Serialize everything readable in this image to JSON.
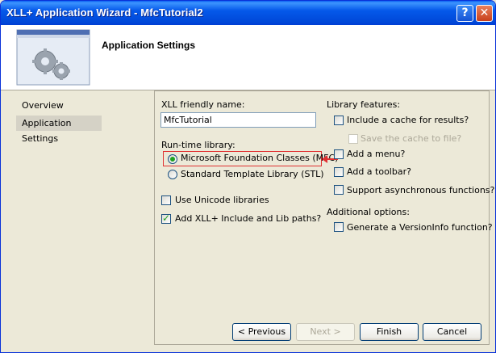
{
  "window": {
    "title": "XLL+ Application Wizard - MfcTutorial2"
  },
  "titlebar": {
    "help_glyph": "?",
    "close_glyph": "✕"
  },
  "header": {
    "title": "Application Settings",
    "image_icon": "gears-window-icon"
  },
  "sidebar": {
    "items": [
      {
        "label": "Overview",
        "selected": false
      },
      {
        "label": "Application Settings",
        "selected": true
      }
    ]
  },
  "form": {
    "friendly_name_label": "XLL friendly name:",
    "friendly_name_value": "MfcTutorial",
    "runtime_label": "Run-time library:",
    "radio_mfc": {
      "label": "Microsoft Foundation Classes (MFC)",
      "selected": true
    },
    "radio_stl": {
      "label": "Standard Template Library (STL)",
      "selected": false
    },
    "unicode": {
      "label": "Use Unicode libraries",
      "checked": false
    },
    "include_paths": {
      "label": "Add XLL+ Include and Lib paths?",
      "checked": true
    }
  },
  "library_features": {
    "label": "Library features:",
    "include_cache": {
      "label": "Include a cache for results?",
      "checked": false
    },
    "save_cache": {
      "label": "Save the cache to file?",
      "checked": false,
      "disabled": true
    },
    "add_menu": {
      "label": "Add a menu?",
      "checked": false
    },
    "add_toolbar": {
      "label": "Add a toolbar?",
      "checked": false
    },
    "async": {
      "label": "Support asynchronous functions?",
      "checked": false
    }
  },
  "additional_options": {
    "label": "Additional options:",
    "versioninfo": {
      "label": "Generate a VersionInfo function?",
      "checked": false
    }
  },
  "buttons": {
    "previous": "< Previous",
    "next": "Next >",
    "finish": "Finish",
    "cancel": "Cancel"
  },
  "colors": {
    "titlebar": "#0054e3",
    "dialog": "#ece9d8",
    "highlight": "#e03030"
  }
}
